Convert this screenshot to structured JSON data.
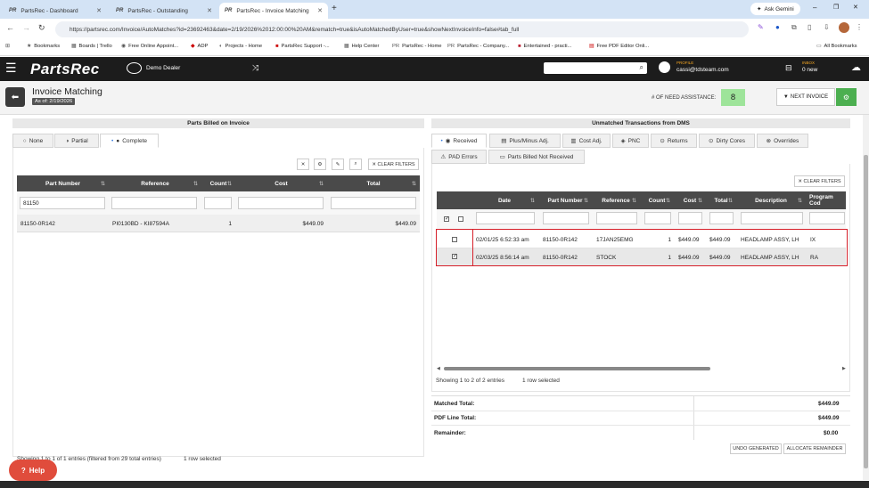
{
  "browser": {
    "tabs": [
      {
        "label": "PartsRec - Dashboard"
      },
      {
        "label": "PartsRec - Outstanding"
      },
      {
        "label": "PartsRec - Invoice Matching"
      }
    ],
    "url": "https://partsrec.com/Invoice/AutoMatches?id=23692463&date=2/19/2026%2012:00:00%20AM&rematch=true&isAutoMatchedByUser=true&showNextInvoiceInfo=false#tab_full",
    "ask_gemini": "Ask Gemini",
    "bookmarks": [
      "Bookmarks",
      "Boards | Trello",
      "Free Online Appoint...",
      "ADP",
      "Projects - Home",
      "PartsRec Support -...",
      "Help Center",
      "PartsRec - Home",
      "PartsRec - Company...",
      "Entertained - practi...",
      "Free PDF Editor Onli..."
    ],
    "all_bookmarks": "All Bookmarks"
  },
  "app": {
    "logo": "PartsRec",
    "dealer": "Demo Dealer",
    "profile_label": "PROFILE",
    "profile_email": "cassi@tdsteam.com",
    "inbox_label": "INBOX",
    "inbox_count": "0 new",
    "page_title": "Invoice Matching",
    "as_of": "As of: 2/19/2026",
    "need_assist_label": "# OF NEED ASSISTANCE:",
    "need_assist_count": "8",
    "next_invoice": "NEXT INVOICE"
  },
  "left": {
    "title": "Parts Billed on Invoice",
    "filters": [
      "None",
      "Partial",
      "Complete"
    ],
    "clear_filters": "CLEAR FILTERS",
    "columns": [
      "Part Number",
      "Reference",
      "Count",
      "Cost",
      "Total"
    ],
    "filter_value": "81150",
    "rows": [
      {
        "part": "81150-0R142",
        "ref": "PI0130BD - KI87594A",
        "count": "1",
        "cost": "$449.09",
        "total": "$449.09"
      }
    ],
    "footer": "Showing 1 to 1 of 1 entries (filtered from 29 total entries)",
    "selected": "1 row selected"
  },
  "right": {
    "title": "Unmatched Transactions from DMS",
    "tabs": [
      "Received",
      "Plus/Minus Adj.",
      "Cost Adj.",
      "PNC",
      "Returns",
      "Dirty Cores",
      "Overrides",
      "PAD Errors",
      "Parts Billed Not Received"
    ],
    "clear_filters": "CLEAR FILTERS",
    "columns": [
      "Date",
      "Part Number",
      "Reference",
      "Count",
      "Cost",
      "Total",
      "Description",
      "Program Cod"
    ],
    "rows": [
      {
        "date": "02/01/25 6:52:33 am",
        "part": "81150-0R142",
        "ref": "17JAN25EMG",
        "count": "1",
        "cost": "$449.09",
        "total": "$449.09",
        "desc": "HEADLAMP ASSY, LH",
        "prog": "IX",
        "checked": ""
      },
      {
        "date": "02/03/25 8:56:14 am",
        "part": "81150-0R142",
        "ref": "STOCK",
        "count": "1",
        "cost": "$449.09",
        "total": "$449.09",
        "desc": "HEADLAMP ASSY, LH",
        "prog": "RA",
        "checked": "✓"
      }
    ],
    "footer": "Showing 1 to 2 of 2 entries",
    "selected": "1 row selected",
    "totals": [
      {
        "label": "Matched Total:",
        "value": "$449.09"
      },
      {
        "label": "PDF Line Total:",
        "value": "$449.09"
      },
      {
        "label": "Remainder:",
        "value": "$0.00"
      }
    ],
    "undo": "UNDO GENERATED",
    "allocate": "ALLOCATE REMAINDER"
  },
  "help": "Help"
}
